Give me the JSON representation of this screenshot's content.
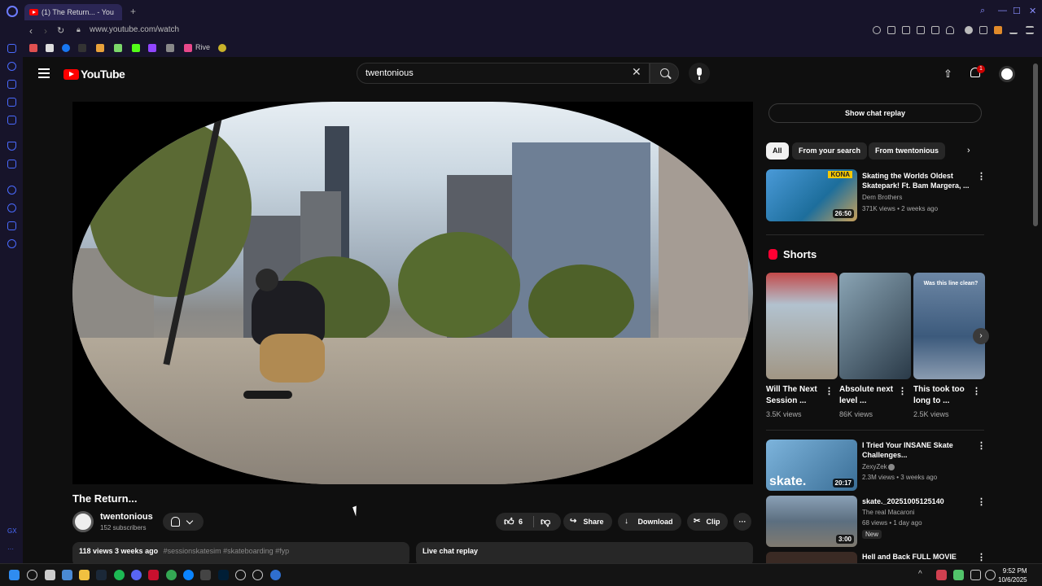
{
  "browser": {
    "tab_title": "(1) The Return... - You",
    "url": "www.youtube.com/watch",
    "bookmark_label": "Rive"
  },
  "youtube": {
    "logo_text": "YouTube",
    "search_query": "twentonious",
    "notification_count": "1"
  },
  "video": {
    "title": "The Return...",
    "channel": "twentonious",
    "subscribers": "152 subscribers",
    "likes": "6",
    "share_label": "Share",
    "download_label": "Download",
    "clip_label": "Clip",
    "views_date": "118 views  3 weeks ago",
    "hashtags": "#sessionskatesim #skateboarding #fyp",
    "live_chat_label": "Live chat replay"
  },
  "sidebar": {
    "chat_replay_button": "Show chat replay",
    "chips": [
      "All",
      "From your search",
      "From twentonious"
    ],
    "recommendations": [
      {
        "title": "Skating the Worlds Oldest Skatepark! Ft. Bam Margera, ...",
        "channel": "Dem Brothers",
        "meta": "371K views • 2 weeks ago",
        "duration": "26:50",
        "thumb_badge": "KONA"
      },
      {
        "title": "I Tried Your INSANE Skate Challenges...",
        "channel": "ZexyZek",
        "meta": "2.3M views • 3 weeks ago",
        "duration": "20:17",
        "thumb_badge": "skate."
      },
      {
        "title": "skate._20251005125140",
        "channel": "The real Macaroni",
        "meta": "68 views • 1 day ago",
        "duration": "3:00",
        "badge": "New"
      },
      {
        "title": "Hell and Back FULL MOVIE",
        "channel": "",
        "meta": "",
        "duration": ""
      }
    ],
    "shorts_label": "Shorts",
    "shorts": [
      {
        "title": "Will The Next Session ...",
        "views": "3.5K views"
      },
      {
        "title": "Absolute next level ...",
        "views": "86K views"
      },
      {
        "title": "This took too long to ...",
        "views": "2.5K views",
        "overlay": "Was this line clean?"
      }
    ]
  },
  "taskbar": {
    "time": "9:52 PM",
    "date": "10/6/2025"
  },
  "colors": {
    "yt_red": "#ff0000",
    "background": "#0f0f0f",
    "chip_bg": "#272727"
  }
}
